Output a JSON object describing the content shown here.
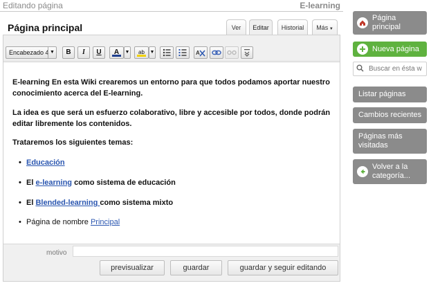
{
  "header": {
    "mode": "Editando página",
    "wiki_name": "E-learning"
  },
  "page": {
    "title": "Página principal"
  },
  "tabs": [
    {
      "label": "Ver"
    },
    {
      "label": "Editar"
    },
    {
      "label": "Historial"
    },
    {
      "label": "Más"
    }
  ],
  "toolbar": {
    "format_select": "Encabezado 4",
    "bold": "B",
    "italic": "I",
    "underline": "U",
    "font_color": "A",
    "highlight": "ab"
  },
  "content": {
    "p1": "E-learning En esta Wiki crearemos un entorno para que todos podamos aportar nuestro conocimiento acerca del E-learning.",
    "p2": "La idea es que será un esfuerzo colaborativo, libre y accesible por todos, donde podrán editar libremente los contenidos.",
    "p3": "Trataremos los siguientes temas:",
    "bullet": "•",
    "items": [
      {
        "link": "Educación"
      },
      {
        "pre": "El ",
        "link": "e-learning",
        "post": " como sistema de educación"
      },
      {
        "pre": "El ",
        "link": "Blended-learning ",
        "post": "como sistema mixto"
      },
      {
        "pre": "Página de nombre ",
        "link": "Principal"
      }
    ]
  },
  "form": {
    "motivo_label": "motivo",
    "motivo_value": "",
    "preview": "previsualizar",
    "save": "guardar",
    "save_continue": "guardar y seguir editando"
  },
  "sidebar": {
    "home": "Página principal",
    "new_page": "Nueva página",
    "search_placeholder": "Buscar en ésta w",
    "list": "Listar páginas",
    "recent": "Cambios recientes",
    "most_visited": "Páginas más visitadas",
    "back": "Volver a la categoría..."
  },
  "colors": {
    "link": "#2a56b0",
    "sidebar_gray": "#8b8b8b",
    "sidebar_green": "#5fb23f"
  }
}
